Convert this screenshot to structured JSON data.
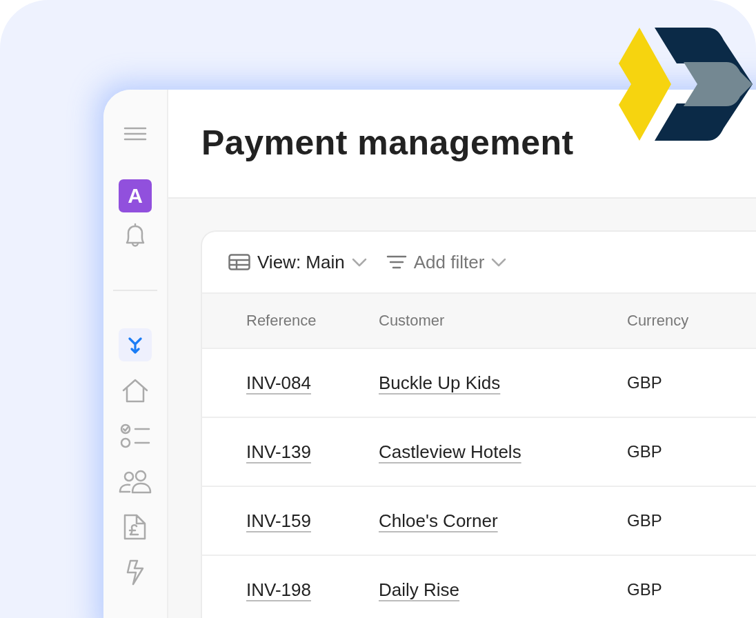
{
  "page": {
    "title": "Payment management"
  },
  "sidebar": {
    "avatar": "A",
    "nav_items": [
      {
        "kind": "merge",
        "selected": true
      },
      {
        "kind": "home",
        "selected": false
      },
      {
        "kind": "tasks",
        "selected": false
      },
      {
        "kind": "people",
        "selected": false
      },
      {
        "kind": "invoice",
        "selected": false
      },
      {
        "kind": "bolt",
        "selected": false
      }
    ]
  },
  "toolbar": {
    "view": "View: Main",
    "filter": "Add filter"
  },
  "table": {
    "columns": [
      "Reference",
      "Customer",
      "Currency"
    ],
    "rows": [
      {
        "reference": "INV-084",
        "customer": "Buckle Up Kids",
        "currency": "GBP"
      },
      {
        "reference": "INV-139",
        "customer": "Castleview Hotels",
        "currency": "GBP"
      },
      {
        "reference": "INV-159",
        "customer": "Chloe's Corner",
        "currency": "GBP"
      },
      {
        "reference": "INV-198",
        "customer": "Daily Rise",
        "currency": "GBP"
      }
    ]
  }
}
